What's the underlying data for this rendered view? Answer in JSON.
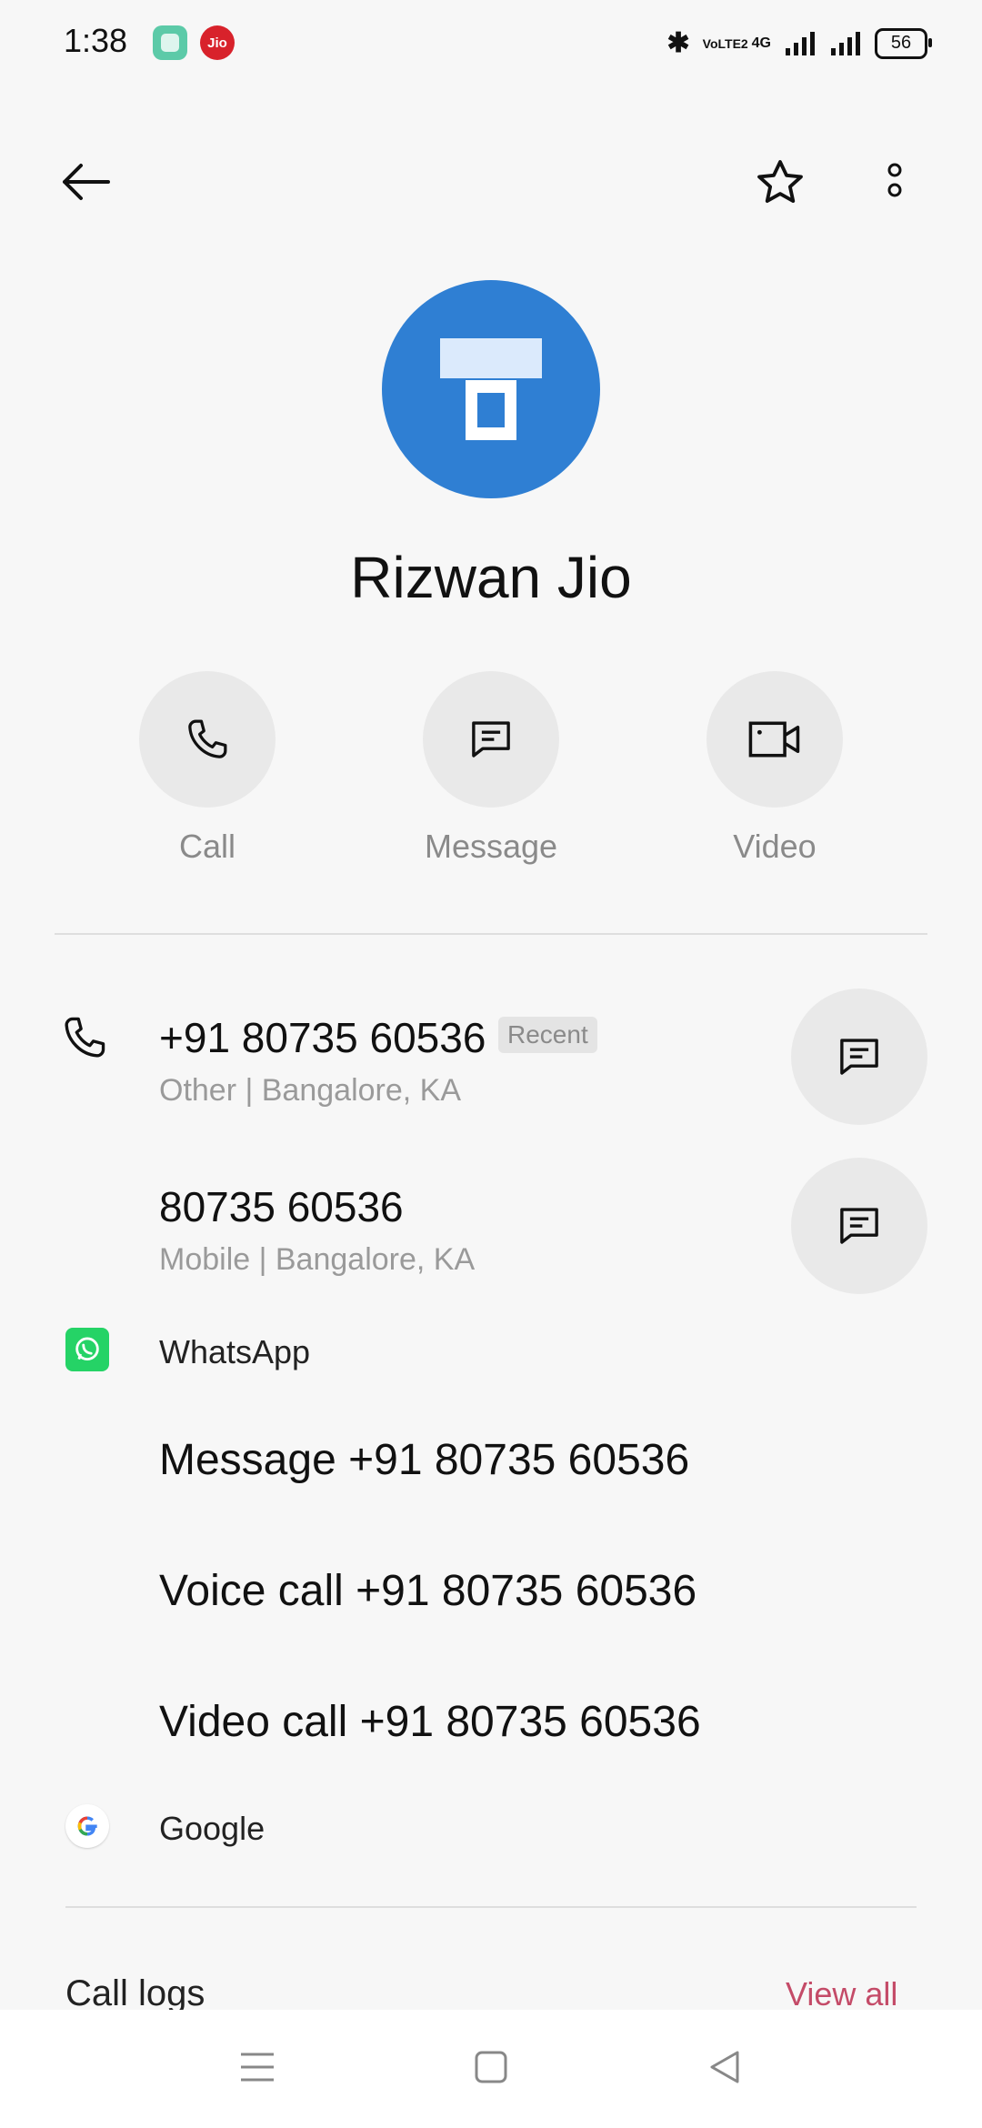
{
  "status_bar": {
    "time": "1:38",
    "signal_label_1": "VoLTE2",
    "network": "4G",
    "battery": "56"
  },
  "contact": {
    "name": "Rizwan Jio",
    "avatar_color": "#2f7fd3"
  },
  "actions": {
    "call": "Call",
    "message": "Message",
    "video": "Video"
  },
  "numbers": [
    {
      "number": "+91 80735 60536",
      "badge": "Recent",
      "detail": "Other | Bangalore, KA"
    },
    {
      "number": "80735 60536",
      "detail": "Mobile | Bangalore, KA"
    }
  ],
  "whatsapp": {
    "label": "WhatsApp",
    "options": [
      "Message +91 80735 60536",
      "Voice call +91 80735 60536",
      "Video call +91 80735 60536"
    ]
  },
  "google": {
    "label": "Google"
  },
  "call_logs": {
    "title": "Call logs",
    "view_all": "View all"
  },
  "colors": {
    "accent_link": "#c44b68",
    "whatsapp_green": "#25d366"
  }
}
